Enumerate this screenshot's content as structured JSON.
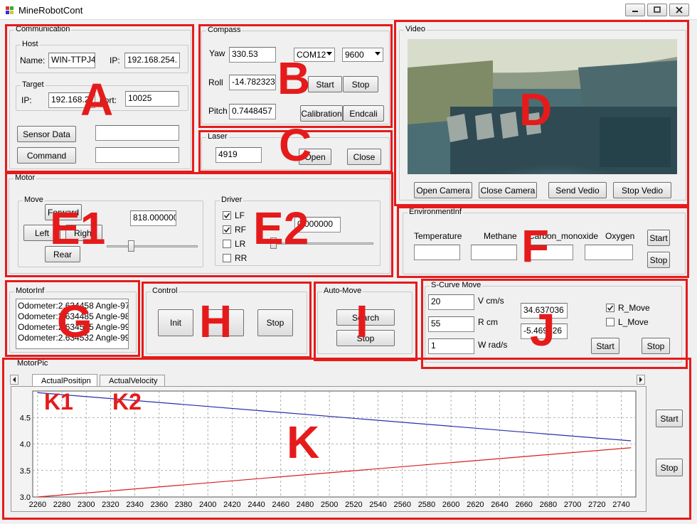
{
  "window": {
    "title": "MineRobotCont"
  },
  "communication": {
    "title": "Communication",
    "host_title": "Host",
    "name_label": "Name:",
    "name_value": "WIN-TTPJ4",
    "ip_label": "IP:",
    "host_ip_value": "192.168.254.",
    "target_title": "Target",
    "target_ip_label": "IP:",
    "target_ip_value": "192.168.2",
    "port_label": "port:",
    "port_value": "10025",
    "sensor_button": "Sensor Data",
    "command_button": "Command",
    "sensor_value": "",
    "command_value": ""
  },
  "compass": {
    "title": "Compass",
    "yaw_label": "Yaw",
    "yaw_value": "330.53",
    "roll_label": "Roll",
    "roll_value": "-14.782323",
    "pitch_label": "Pitch",
    "pitch_value": "0.7448457",
    "com_port": "COM12",
    "baud": "9600",
    "start": "Start",
    "stop": "Stop",
    "calibration": "Calibration",
    "endcali": "Endcali"
  },
  "laser": {
    "title": "Laser",
    "value": "4919",
    "open": "Open",
    "close": "Close"
  },
  "video": {
    "title": "Video",
    "open_camera": "Open Camera",
    "close_camera": "Close Camera",
    "send_video": "Send Vedio",
    "stop_video": "Stop Vedio"
  },
  "motor": {
    "title": "Motor",
    "move_title": "Move",
    "forward": "Forward",
    "left": "Left",
    "right": "Right",
    "rear": "Rear",
    "speed_value": "818.000000",
    "move_slider_value": 0.25,
    "driver_title": "Driver",
    "lf": "LF",
    "rf": "RF",
    "lr": "LR",
    "rr": "RR",
    "lf_checked": true,
    "rf_checked": true,
    "lr_checked": false,
    "rr_checked": false,
    "driver_value": "0.000000",
    "driver_slider_value": 0.0
  },
  "environment": {
    "title": "EnvironmentInf",
    "temperature": "Temperature",
    "methane": "Methane",
    "carbon_monoxide": "Carbon_monoxide",
    "oxygen": "Oxygen",
    "start": "Start",
    "stop": "Stop"
  },
  "motor_inf": {
    "title": "MotorInf",
    "lines": [
      "Odometer:2.634458 Angle-97",
      "Odometer:2.634485 Angle-98",
      "Odometer:2.634515 Angle-99",
      "Odometer:2.634532 Angle-99"
    ]
  },
  "control": {
    "title": "Control",
    "init": "Init",
    "stop": "Stop"
  },
  "auto_move": {
    "title": "Auto-Move",
    "search": "Search",
    "stop": "Stop"
  },
  "s_curve": {
    "title": "S-Curve Move",
    "v_value": "20",
    "v_label": "V cm/s",
    "r_value": "55",
    "r_label": "R cm",
    "w_value": "1",
    "w_label": "W rad/s",
    "out1": "34.637036",
    "out2": "-5.469426",
    "r_move": "R_Move",
    "l_move": "L_Move",
    "r_move_checked": true,
    "l_move_checked": false,
    "start": "Start",
    "stop": "Stop"
  },
  "motor_pic": {
    "title": "MotorPic",
    "tabs": [
      "ActualPositipn",
      "ActualVelocity"
    ],
    "start": "Start",
    "stop": "Stop"
  },
  "annotations": {
    "A": "A",
    "B": "B",
    "C": "C",
    "D": "D",
    "E1": "E1",
    "E2": "E2",
    "F": "F",
    "G": "G",
    "H": "H",
    "I": "I",
    "J": "J",
    "K": "K",
    "K1": "K1",
    "K2": "K2"
  },
  "colors": {
    "annotation_red": "#e51b1b",
    "series_blue": "#2b2bb0",
    "series_red": "#d81e1e"
  },
  "chart_data": {
    "type": "line",
    "x": [
      2260,
      2748
    ],
    "series": [
      {
        "values": [
          4.97,
          4.06
        ]
      },
      {
        "values": [
          3.0,
          3.93
        ]
      }
    ],
    "xticks": [
      2260,
      2280,
      2300,
      2320,
      2340,
      2360,
      2380,
      2400,
      2420,
      2440,
      2460,
      2480,
      2500,
      2520,
      2540,
      2560,
      2580,
      2600,
      2620,
      2640,
      2660,
      2680,
      2700,
      2720,
      2740
    ],
    "yticks": [
      3.0,
      3.5,
      4.0,
      4.5
    ],
    "xlim": [
      2256,
      2752
    ],
    "ylim": [
      3.0,
      5.0
    ],
    "grid": true
  }
}
